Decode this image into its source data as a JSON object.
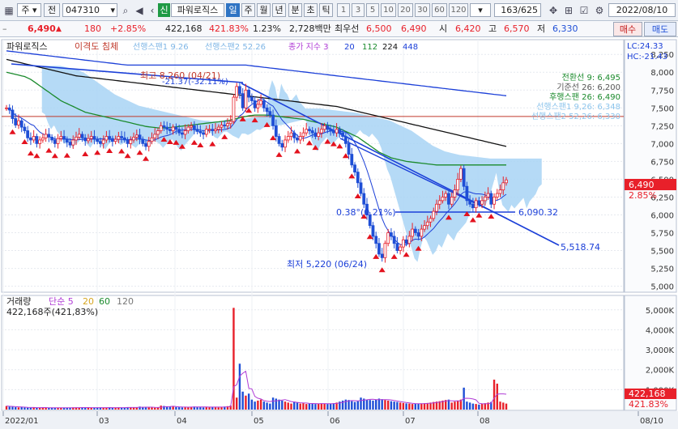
{
  "toolbar": {
    "market": "주",
    "mode": "전",
    "code": "047310",
    "name_badge": "신",
    "stock_name": "파워로직스",
    "periods": [
      "일",
      "주",
      "월",
      "년",
      "분",
      "초",
      "틱"
    ],
    "active_period": "일",
    "intervals": [
      "1",
      "3",
      "5",
      "10",
      "20",
      "30",
      "60",
      "120"
    ],
    "page_counter": "163/625",
    "date": "2022/08/10"
  },
  "info": {
    "price": "6,490",
    "change": "180",
    "change_pct": "+2.85%",
    "volume": "422,168",
    "volume_ratio": "421.83%",
    "turnover": "1.23%",
    "amount": "2,728백만",
    "best_label": "최우선",
    "ask": "6,500",
    "bid": "6,490",
    "open_label": "시",
    "open": "6,420",
    "high_label": "고",
    "high": "6,570",
    "low_label": "저",
    "low": "6,330",
    "buy_label": "매수",
    "sell_label": "매도"
  },
  "legend": {
    "name": "파워로직스",
    "ma_label": "이격도 침체",
    "span1": "선행스팬1 9.26",
    "span2": "선행스팬2 52.26",
    "close_idx": "종가 지수 3",
    "ma_periods": [
      "20",
      "112",
      "224",
      "448"
    ],
    "lc": "LC:24.33",
    "hc": "HC:-21.43"
  },
  "ichimoku": {
    "tenkan": "전환선 9: 6,495",
    "kijun": "기준선 26: 6,200",
    "chikou": "후행스팬 26: 6,490",
    "span1": "선행스팬1 9,26: 6,348",
    "span2": "선행스팬2 52,26: 6,330"
  },
  "annotations": {
    "high": "최고 8,260 (04/21)",
    "high_pct": "-21.37(-32.11%)",
    "low": "최저 5,220 (06/24)",
    "fib": "0.38°(0.21%)",
    "line1": "6,090.32",
    "line2": "5,518.74"
  },
  "price_tag": {
    "value": "6,490",
    "pct": "2.85%"
  },
  "volume_panel": {
    "title": "거래량",
    "ma_label": "단순 5",
    "ma_periods": [
      "20",
      "60",
      "120"
    ],
    "last": "422,168주(421,83%)",
    "tag_value": "422,168",
    "tag_pct": "421.83%"
  },
  "colors": {
    "up": "#e8202a",
    "down": "#1f4fd6",
    "cloud": "#a8d4f4",
    "ma1": "#1a8a2c",
    "ma2": "#111111",
    "ma3": "#1b3fd8"
  },
  "chart_data": {
    "type": "candlestick",
    "price_axis": [
      "8,250",
      "8,000",
      "7,750",
      "7,500",
      "7,250",
      "7,000",
      "6,750",
      "6,500",
      "6,250",
      "6,000",
      "5,750",
      "5,500",
      "5,250",
      "5,000"
    ],
    "price_range": [
      4950,
      8400
    ],
    "volume_axis": [
      "5,000K",
      "4,000K",
      "3,000K",
      "2,000K",
      "1,000K"
    ],
    "volume_range": [
      0,
      5600
    ],
    "x_labels": [
      "2022/01",
      "03",
      "04",
      "05",
      "06",
      "07",
      "08",
      "08/10"
    ],
    "close": [
      7500,
      7470,
      7350,
      7260,
      7320,
      7230,
      7180,
      7080,
      7050,
      7100,
      7000,
      7050,
      7080,
      7130,
      7090,
      7050,
      7000,
      7070,
      7100,
      7060,
      7020,
      6980,
      7050,
      7090,
      7130,
      7080,
      7040,
      7070,
      7100,
      7060,
      7030,
      7000,
      7050,
      7100,
      7070,
      7030,
      7060,
      7100,
      7080,
      7050,
      7000,
      7050,
      7090,
      7120,
      7060,
      7000,
      6960,
      7030,
      7080,
      7130,
      7180,
      7250,
      7230,
      7200,
      7180,
      7230,
      7200,
      7150,
      7130,
      7180,
      7230,
      7250,
      7200,
      7170,
      7150,
      7130,
      7200,
      7200,
      7180,
      7200,
      7230,
      7260,
      7250,
      7280,
      7310,
      7650,
      7800,
      7700,
      7500,
      7750,
      7650,
      7600,
      7500,
      7550,
      7600,
      7500,
      7450,
      7400,
      7250,
      7100,
      7000,
      6950,
      7050,
      7100,
      7150,
      7080,
      7050,
      7100,
      7150,
      7200,
      7180,
      7150,
      7100,
      7150,
      7200,
      7250,
      7200,
      7180,
      7150,
      7200,
      7150,
      7100,
      7000,
      6850,
      6700,
      6600,
      6450,
      6300,
      6150,
      6000,
      5850,
      5700,
      5600,
      5450,
      5400,
      5600,
      5750,
      5700,
      5600,
      5500,
      5550,
      5650,
      5600,
      5700,
      5800,
      5750,
      5700,
      5800,
      5850,
      5900,
      5950,
      6050,
      6150,
      6200,
      6250,
      6300,
      6150,
      6250,
      6350,
      6500,
      6650,
      6400,
      6200,
      6150,
      6100,
      6200,
      6150,
      6200,
      6250,
      6300,
      6150,
      6250,
      6300,
      6350,
      6450,
      6490
    ],
    "volume": [
      180,
      150,
      140,
      120,
      110,
      130,
      100,
      95,
      90,
      110,
      100,
      95,
      105,
      90,
      85,
      95,
      100,
      90,
      85,
      95,
      88,
      92,
      110,
      105,
      98,
      102,
      95,
      100,
      90,
      95,
      100,
      105,
      98,
      95,
      100,
      90,
      95,
      110,
      100,
      95,
      120,
      110,
      100,
      105,
      150,
      130,
      120,
      110,
      100,
      95,
      100,
      200,
      180,
      160,
      140,
      150,
      130,
      120,
      110,
      120,
      130,
      140,
      150,
      130,
      120,
      110,
      130,
      140,
      130,
      120,
      110,
      130,
      150,
      170,
      200,
      5100,
      600,
      2300,
      900,
      700,
      800,
      500,
      400,
      450,
      500,
      400,
      350,
      300,
      600,
      550,
      500,
      450,
      400,
      350,
      300,
      400,
      350,
      300,
      320,
      280,
      300,
      320,
      280,
      300,
      310,
      290,
      280,
      300,
      320,
      350,
      400,
      450,
      500,
      480,
      420,
      380,
      420,
      600,
      550,
      500,
      480,
      450,
      500,
      550,
      520,
      480,
      450,
      420,
      400,
      380,
      350,
      330,
      310,
      300,
      280,
      290,
      300,
      310,
      320,
      330,
      350,
      380,
      400,
      420,
      450,
      480,
      500,
      350,
      400,
      450,
      500,
      1100,
      400,
      350,
      300,
      280,
      250,
      300,
      320,
      350,
      380,
      1500,
      1300,
      400,
      350,
      300,
      422
    ],
    "moving_averages": [
      {
        "name": "112",
        "values": [
          8000,
          7990,
          7980,
          7970,
          7960,
          7950,
          7940,
          7920,
          7900,
          7870,
          7840,
          7810,
          7780,
          7750,
          7720,
          7690,
          7660,
          7630,
          7600,
          7580,
          7560,
          7540,
          7520,
          7500,
          7480,
          7460,
          7440,
          7430,
          7420,
          7410,
          7400,
          7390,
          7380,
          7370,
          7360,
          7350,
          7340,
          7330,
          7320,
          7310,
          7300,
          7290,
          7280,
          7270,
          7260,
          7250,
          7240,
          7235,
          7230,
          7225,
          7220,
          7220,
          7220,
          7220,
          7225,
          7230,
          7235,
          7240,
          7245,
          7250,
          7255,
          7260,
          7265,
          7270,
          7275,
          7280,
          7285,
          7290,
          7295,
          7300,
          7305,
          7310,
          7315,
          7320,
          7330,
          7340,
          7350,
          7360,
          7370,
          7380,
          7390,
          7395,
          7400,
          7400,
          7400,
          7400,
          7400,
          7395,
          7390,
          7385,
          7380,
          7375,
          7370,
          7365,
          7360,
          7355,
          7350,
          7345,
          7340,
          7330,
          7320,
          7310,
          7300,
          7290,
          7280,
          7270,
          7260,
          7250,
          7240,
          7230,
          7210,
          7190,
          7170,
          7150,
          7130,
          7110,
          7090,
          7060,
          7030,
          7000,
          6970,
          6940,
          6910,
          6880,
          6860,
          6840,
          6820,
          6800,
          6790,
          6780,
          6770,
          6760,
          6750,
          6745,
          6740,
          6735,
          6730,
          6725,
          6720,
          6715,
          6710,
          6705,
          6700,
          6700,
          6700,
          6700,
          6700,
          6700,
          6700,
          6700,
          6700,
          6700,
          6700,
          6700,
          6700,
          6700,
          6700,
          6700,
          6700,
          6700,
          6700,
          6700,
          6700,
          6700,
          6700,
          6700
        ]
      },
      {
        "name": "224",
        "values": [
          8180,
          8170,
          8160,
          8150,
          8140,
          8130,
          8120,
          8110,
          8100,
          8090,
          8080,
          8070,
          8060,
          8050,
          8040,
          8030,
          8020,
          8010,
          8000,
          7990,
          7980,
          7970,
          7960,
          7950,
          7945,
          7940,
          7935,
          7930,
          7925,
          7920,
          7915,
          7910,
          7905,
          7900,
          7895,
          7890,
          7885,
          7880,
          7875,
          7870,
          7865,
          7860,
          7855,
          7850,
          7845,
          7840,
          7835,
          7830,
          7825,
          7820,
          7815,
          7810,
          7805,
          7800,
          7795,
          7790,
          7785,
          7780,
          7775,
          7770,
          7765,
          7760,
          7755,
          7750,
          7745,
          7740,
          7735,
          7730,
          7725,
          7720,
          7715,
          7710,
          7705,
          7700,
          7695,
          7690,
          7685,
          7680,
          7675,
          7670,
          7665,
          7660,
          7655,
          7650,
          7645,
          7640,
          7635,
          7630,
          7625,
          7620,
          7615,
          7610,
          7605,
          7600,
          7595,
          7590,
          7585,
          7580,
          7575,
          7570,
          7565,
          7560,
          7555,
          7550,
          7545,
          7540,
          7535,
          7530,
          7525,
          7520,
          7510,
          7500,
          7490,
          7480,
          7470,
          7460,
          7450,
          7440,
          7430,
          7420,
          7410,
          7400,
          7390,
          7380,
          7370,
          7360,
          7350,
          7340,
          7330,
          7320,
          7310,
          7300,
          7290,
          7280,
          7270,
          7260,
          7250,
          7240,
          7230,
          7220,
          7210,
          7200,
          7190,
          7180,
          7170,
          7160,
          7150,
          7140,
          7130,
          7120,
          7110,
          7100,
          7090,
          7080,
          7070,
          7060,
          7050,
          7040,
          7030,
          7020,
          7010,
          7000,
          6990,
          6980,
          6970,
          6960
        ]
      },
      {
        "name": "448",
        "values": [
          8300,
          8295,
          8290,
          8285,
          8280,
          8275,
          8270,
          8265,
          8260,
          8255,
          8250,
          8245,
          8240,
          8235,
          8230,
          8225,
          8220,
          8215,
          8210,
          8205,
          8200,
          8195,
          8190,
          8185,
          8180,
          8175,
          8170,
          8165,
          8160,
          8155,
          8150,
          8145,
          8140,
          8135,
          8130,
          8125,
          8120,
          8115,
          8110,
          8105,
          8100,
          8100,
          8100,
          8100,
          8100,
          8100,
          8100,
          8100,
          8100,
          8100,
          8100,
          8100,
          8100,
          8100,
          8100,
          8100,
          8100,
          8100,
          8100,
          8100,
          8100,
          8100,
          8100,
          8100,
          8100,
          8100,
          8100,
          8100,
          8100,
          8100,
          8100,
          8100,
          8100,
          8100,
          8100,
          8100,
          8100,
          8100,
          8100,
          8100,
          8095,
          8090,
          8085,
          8080,
          8075,
          8070,
          8065,
          8060,
          8055,
          8050,
          8045,
          8040,
          8035,
          8030,
          8025,
          8020,
          8015,
          8010,
          8005,
          8000,
          7995,
          7990,
          7985,
          7980,
          7975,
          7970,
          7965,
          7960,
          7955,
          7950,
          7945,
          7940,
          7935,
          7930,
          7925,
          7920,
          7915,
          7910,
          7905,
          7900,
          7895,
          7890,
          7885,
          7880,
          7875,
          7870,
          7865,
          7860,
          7855,
          7850,
          7845,
          7840,
          7835,
          7830,
          7825,
          7820,
          7815,
          7810,
          7805,
          7800,
          7795,
          7790,
          7785,
          7780,
          7775,
          7770,
          7765,
          7760,
          7755,
          7750,
          7745,
          7740,
          7735,
          7730,
          7725,
          7720,
          7715,
          7710,
          7705,
          7700,
          7695,
          7690,
          7685,
          7680,
          7675,
          7670
        ]
      }
    ],
    "horizontal_line": 7380
  }
}
